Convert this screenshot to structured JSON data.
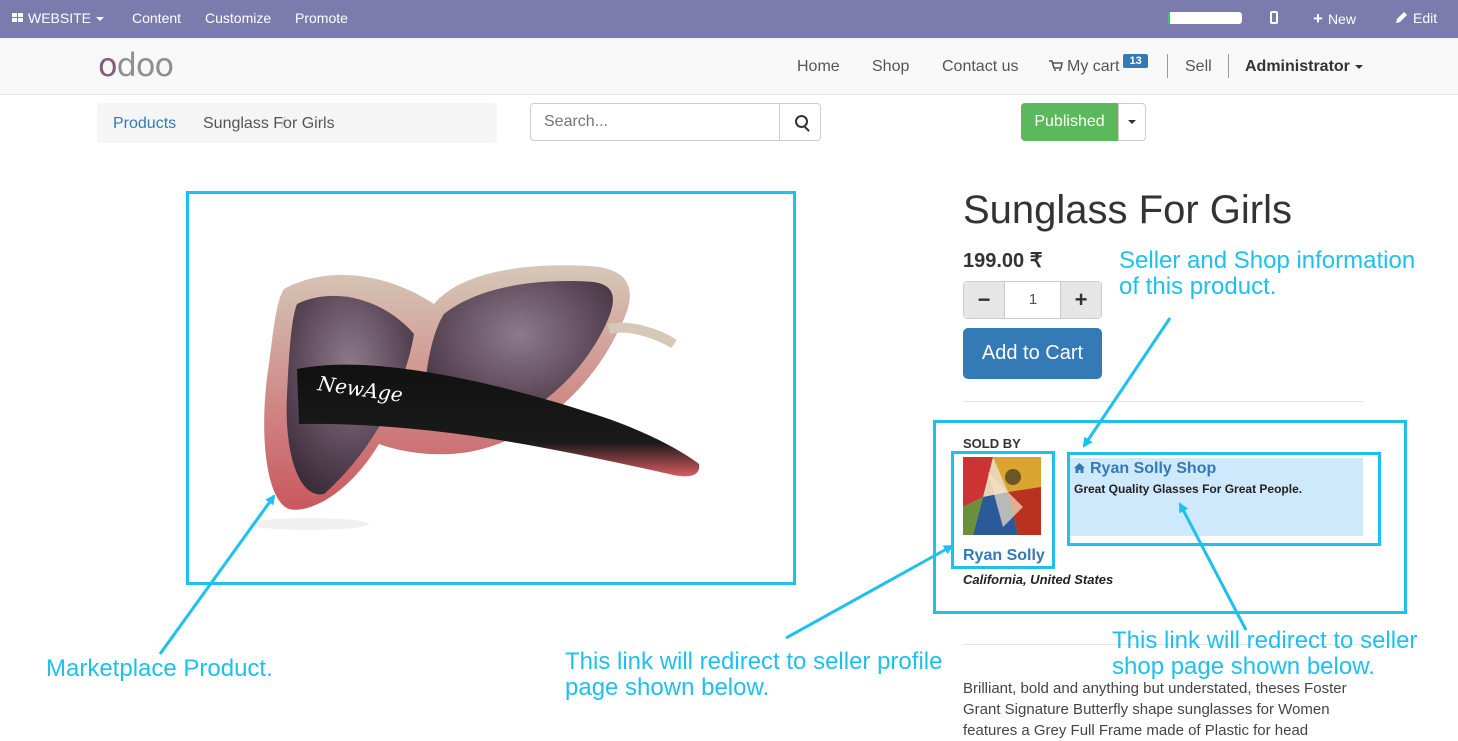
{
  "admin_bar": {
    "website_label": "WEBSITE",
    "content_label": "Content",
    "customize_label": "Customize",
    "promote_label": "Promote",
    "new_label": "New",
    "edit_label": "Edit",
    "progress_fraction": 0.03
  },
  "navbar": {
    "logo_first": "o",
    "logo_rest": "doo",
    "links": [
      "Home",
      "Shop",
      "Contact us"
    ],
    "cart_label": "My cart",
    "cart_count": "13",
    "sell_label": "Sell",
    "user_label": "Administrator"
  },
  "breadcrumb": {
    "parent": "Products",
    "separator": "/",
    "current": "Sunglass For Girls"
  },
  "search": {
    "placeholder": "Search..."
  },
  "publish": {
    "label": "Published"
  },
  "product": {
    "title": "Sunglass For Girls",
    "price": "199.00 ₹",
    "quantity": "1",
    "minus": "−",
    "plus": "+",
    "add_to_cart": "Add to Cart",
    "description": "Brilliant, bold and anything but understated, theses Foster Grant Signature Butterfly shape sunglasses for Women features a Grey Full Frame made of Plastic for head",
    "brand_text": "NewAge"
  },
  "seller": {
    "sold_by": "SOLD BY",
    "name": "Ryan Solly",
    "location": "California, United States",
    "shop_name": "Ryan Solly Shop",
    "shop_tagline": "Great Quality Glasses For Great People."
  },
  "annotations": {
    "product": "Marketplace Product.",
    "seller_info_1": "Seller and Shop information",
    "seller_info_2": "of this product.",
    "profile_1": "This link will redirect to seller profile",
    "profile_2": "page shown below.",
    "shop_1": "This link will redirect to seller",
    "shop_2": "shop page shown below."
  },
  "colors": {
    "admin_bar": "#7c7bad",
    "annotation": "#1ec0ef",
    "primary": "#337ab7",
    "published": "#5cb85c"
  }
}
